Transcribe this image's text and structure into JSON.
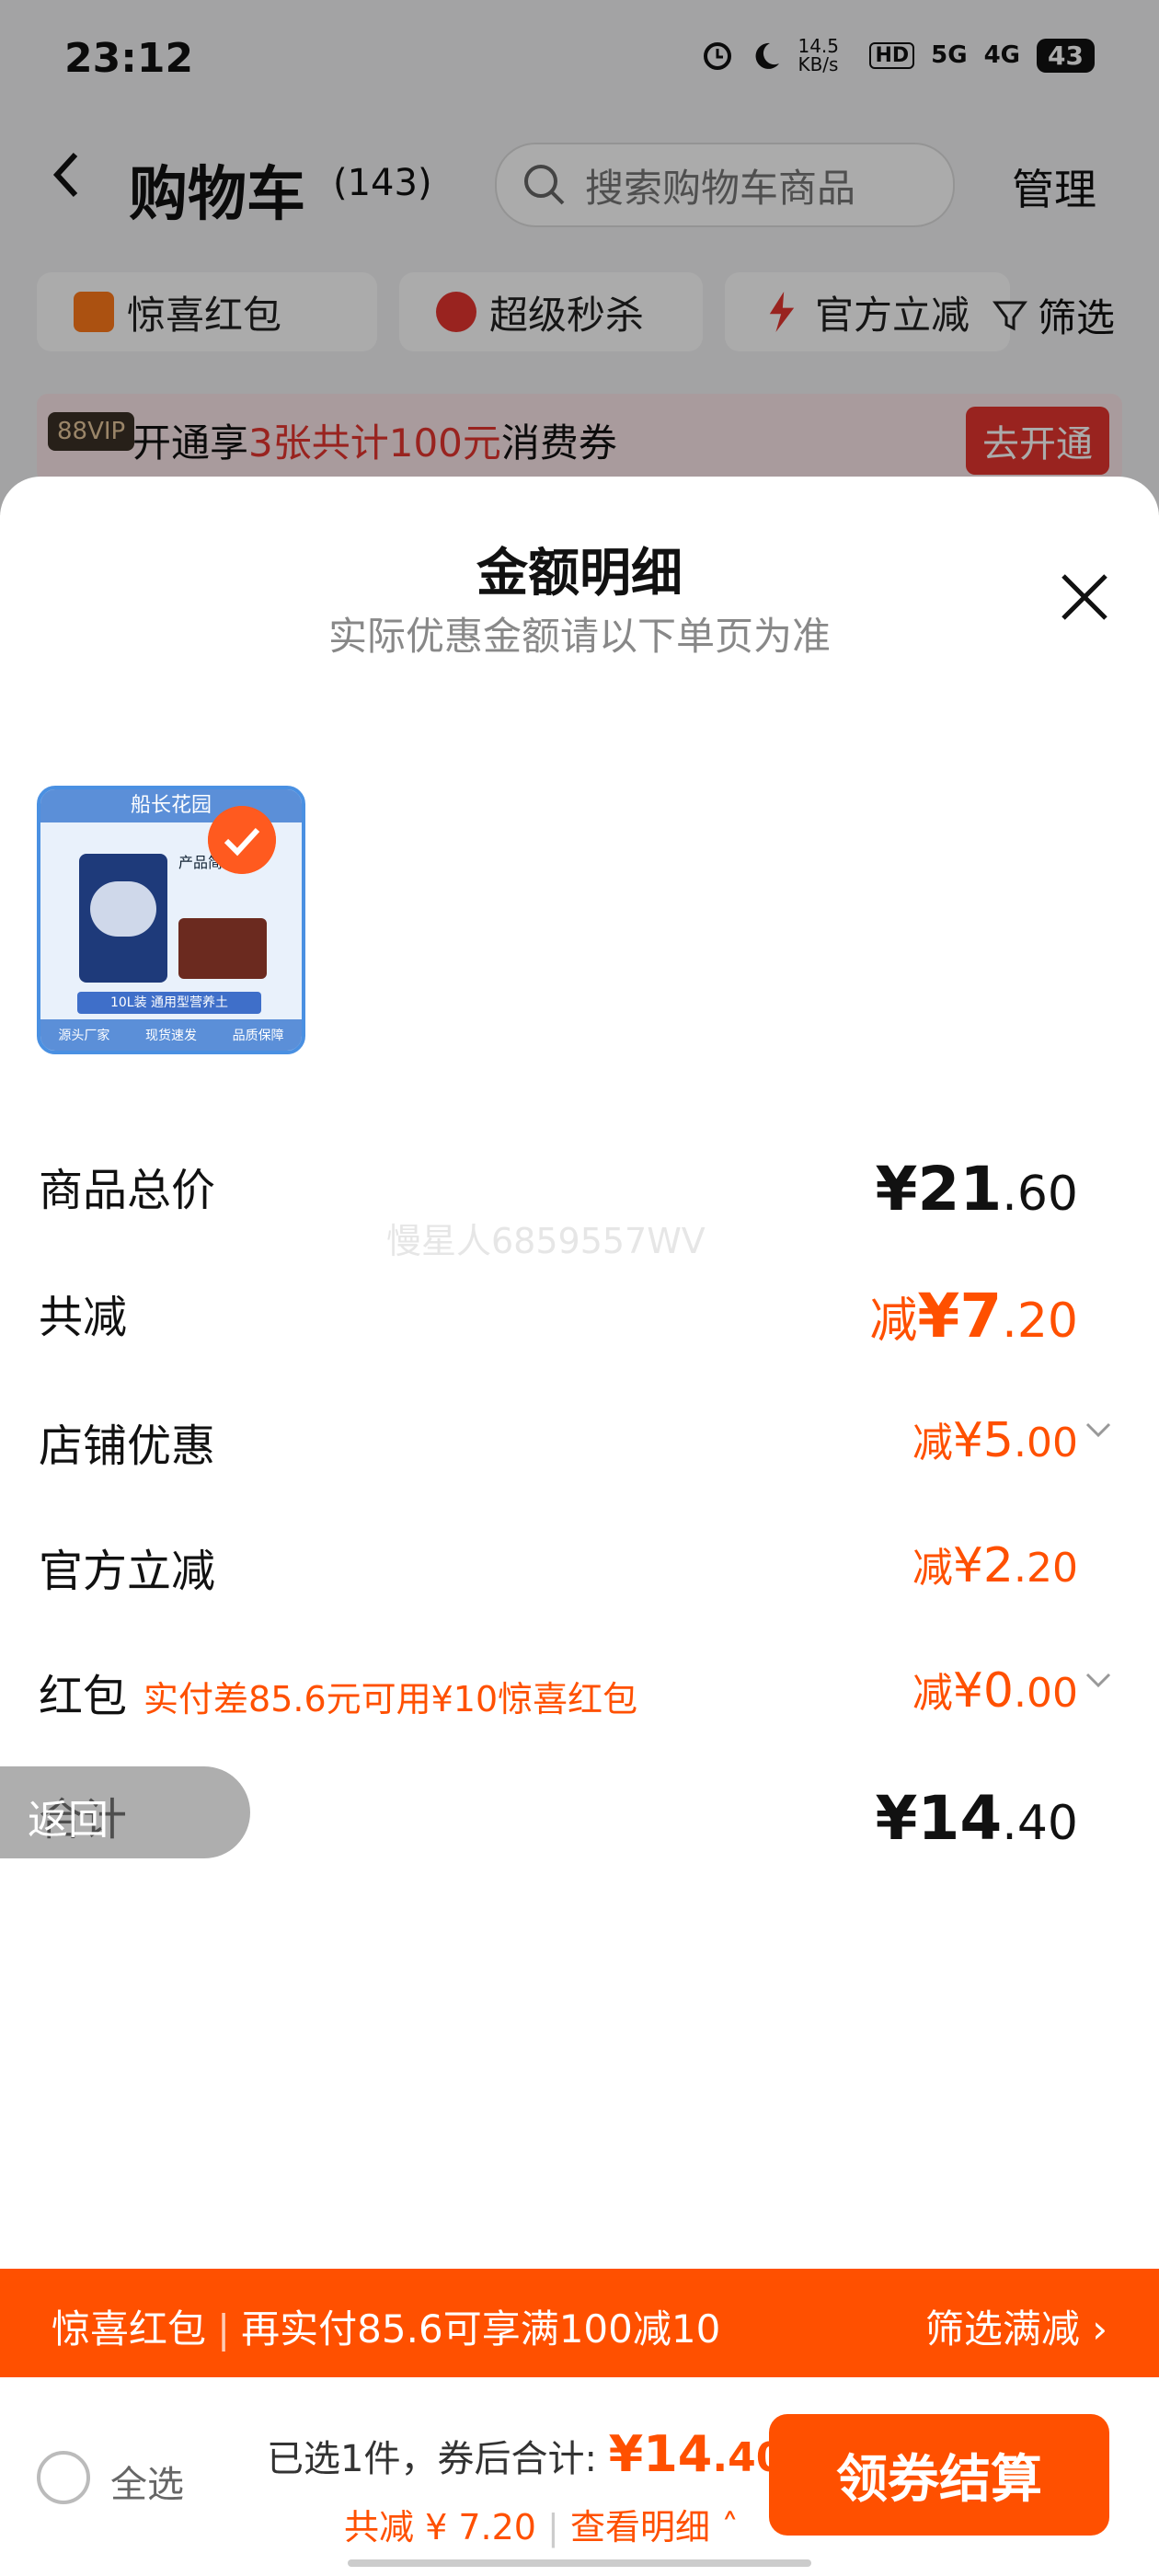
{
  "status_bar": {
    "time": "23:12",
    "net_speed": "14.5 KB/s",
    "hd": "HD",
    "signal1": "5G",
    "signal2": "4G",
    "battery": "43"
  },
  "header": {
    "title": "购物车",
    "count": "(143)",
    "search_placeholder": "搜索购物车商品",
    "manage": "管理"
  },
  "chips": [
    {
      "label": "惊喜红包",
      "icon": "red-packet-icon"
    },
    {
      "label": "超级秒杀",
      "icon": "flash-sale-icon"
    },
    {
      "label": "官方立减",
      "icon": "lightning-icon"
    }
  ],
  "filter": {
    "label": "筛选"
  },
  "vip": {
    "badge": "88VIP",
    "text_prefix": "开通享",
    "highlight": "3张共计100元",
    "text_suffix": "消费券",
    "button": "去开通"
  },
  "sheet": {
    "title": "金额明细",
    "subtitle": "实际优惠金额请以下单页为准",
    "product": {
      "shop_name": "船长花园",
      "intro": "产品简介",
      "strip": "10L装 通用型营养土",
      "foot": [
        "源头厂家",
        "现货速发",
        "品质保障"
      ]
    },
    "rows": [
      {
        "label": "商品总价",
        "currency": "¥",
        "int": "21",
        "dec": ".60",
        "prefix": ""
      },
      {
        "label": "共减",
        "currency": "¥",
        "int": "7",
        "dec": ".20",
        "prefix": "减"
      },
      {
        "label": "店铺优惠",
        "currency": "¥",
        "int": "5",
        "dec": ".00",
        "prefix": "减"
      },
      {
        "label": "官方立减",
        "currency": "¥",
        "int": "2",
        "dec": ".20",
        "prefix": "减"
      },
      {
        "label": "红包",
        "hint": "实付差85.6元可用¥10惊喜红包",
        "currency": "¥",
        "int": "0",
        "dec": ".00",
        "prefix": "减"
      },
      {
        "label": "合计",
        "currency": "¥",
        "int": "14",
        "dec": ".40",
        "prefix": ""
      }
    ],
    "watermark": "慢星人6859557WV",
    "back_label": "返回"
  },
  "promo": {
    "left_a": "惊喜红包",
    "left_b": "再实付85.6可享满100减10",
    "right": "筛选满减"
  },
  "footer": {
    "select_all": "全选",
    "selected": "已选1件，券后合计:",
    "total_currency": "¥",
    "total_int": "14",
    "total_dec": ".40",
    "saved": "共减 ¥ 7.20",
    "detail_link": "查看明细",
    "checkout": "领券结算"
  },
  "colors": {
    "accent": "#ff5000",
    "vip_red": "#e4352f"
  }
}
